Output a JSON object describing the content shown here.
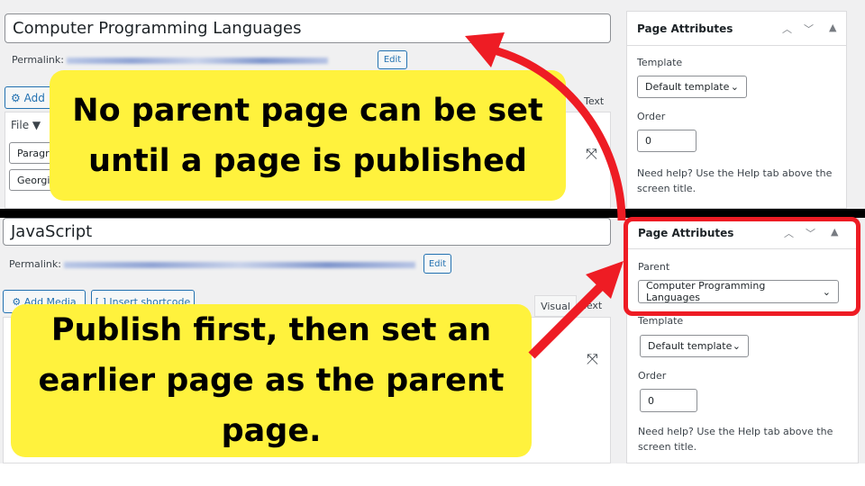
{
  "top": {
    "title": "Computer Programming Languages",
    "permalink_label": "Permalink:",
    "edit": "Edit",
    "add_media": "Add",
    "text_tab": "Text",
    "file_menu": "File ▼",
    "format": "Paragra",
    "font": "Georgi",
    "callout": [
      "No parent page can be set",
      "until a page is published"
    ],
    "sidebar": {
      "header": "Page Attributes",
      "template_label": "Template",
      "template_value": "Default template",
      "order_label": "Order",
      "order_value": "0",
      "help": [
        "Need help? Use the Help tab above the",
        "screen title."
      ]
    }
  },
  "bottom": {
    "title": "JavaScript",
    "permalink_label": "Permalink:",
    "edit": "Edit",
    "add_media": "Add Media",
    "insert_shortcode": "Insert shortcode",
    "visual_tab": "Visual",
    "text_tab": "Text",
    "callout": [
      "Publish first, then set an",
      "earlier page as the parent",
      "page."
    ],
    "sidebar": {
      "header": "Page Attributes",
      "parent_label": "Parent",
      "parent_value": "Computer Programming Languages",
      "template_label": "Template",
      "template_value": "Default template",
      "order_label": "Order",
      "order_value": "0",
      "help": [
        "Need help? Use the Help tab above the",
        "screen title."
      ]
    }
  },
  "colors": {
    "callout": "#fff23d",
    "arrow": "#ee1c24",
    "divider": "#000000"
  }
}
